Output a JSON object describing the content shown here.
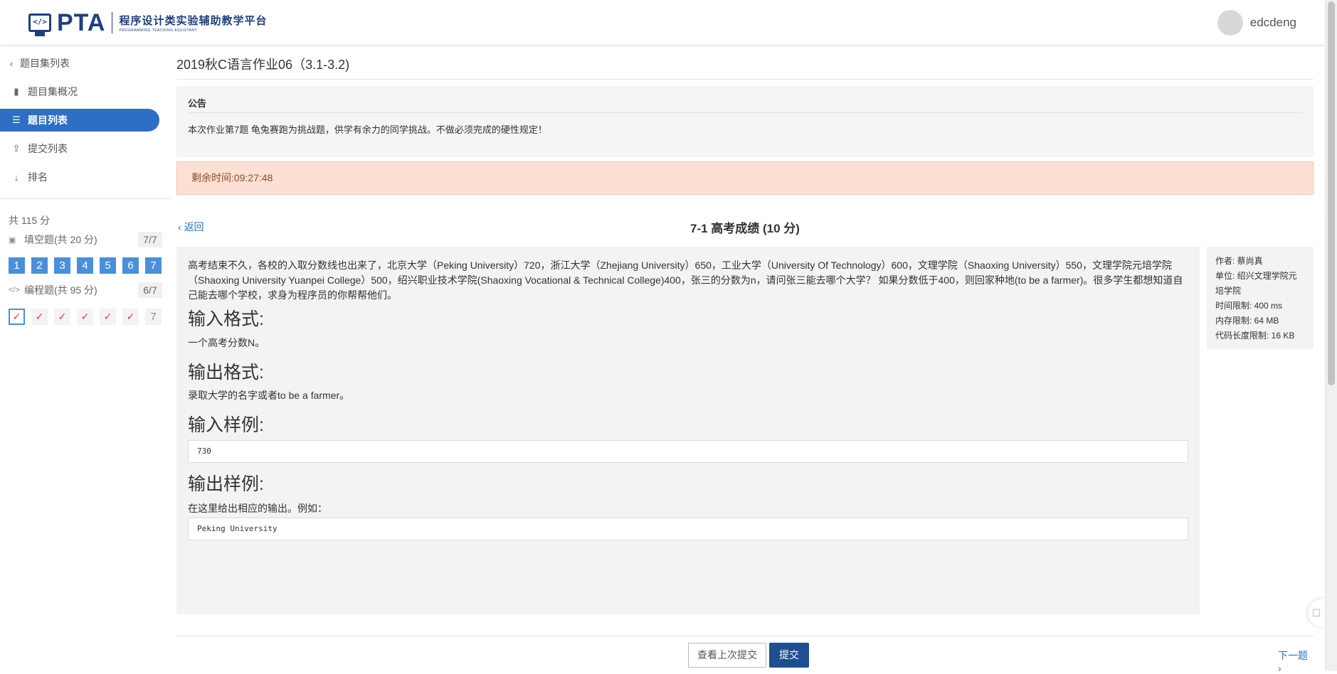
{
  "header": {
    "logo_icon": "</>",
    "logo_text": "PTA",
    "logo_cn": "程序设计类实验辅助教学平台",
    "logo_sub": "PROGRAMMING TEACHING ASSISTANT",
    "username": "edcdeng"
  },
  "sidebar": {
    "back_label": "题目集列表",
    "items": [
      {
        "label": "题目集概况",
        "icon": "book-icon"
      },
      {
        "label": "题目列表",
        "icon": "list-icon"
      },
      {
        "label": "提交列表",
        "icon": "upload-icon"
      },
      {
        "label": "排名",
        "icon": "sort-icon"
      }
    ],
    "total": "共 115 分",
    "fill_section": {
      "label": "填空题(共 20 分)",
      "count": "7/7",
      "questions": [
        "1",
        "2",
        "3",
        "4",
        "5",
        "6",
        "7"
      ]
    },
    "prog_section": {
      "label": "编程题(共 95 分)",
      "count": "6/7",
      "last": "7"
    }
  },
  "main": {
    "set_title": "2019秋C语言作业06（3.1-3.2)",
    "notice_title": "公告",
    "notice_body": "本次作业第7题 龟兔赛跑为挑战题，供学有余力的同学挑战。不做必须完成的硬性规定！",
    "timer": "剩余时间:09:27:48",
    "back": "返回",
    "problem_title": "7-1 高考成绩 (10 分)",
    "description": "高考结束不久，各校的入取分数线也出来了，北京大学（Peking University）720，浙江大学（Zhejiang University）650，工业大学（University Of Technology）600，文理学院（Shaoxing University）550，文理学院元培学院（Shaoxing University Yuanpei College）500，绍兴职业技术学院(Shaoxing Vocational & Technical College)400，张三的分数为n，请问张三能去哪个大学？ 如果分数低于400，则回家种地(to be a farmer)。很多学生都想知道自己能去哪个学校，求身为程序员的你帮帮他们。",
    "input_format_h": "输入格式:",
    "input_format": "一个高考分数N。",
    "output_format_h": "输出格式:",
    "output_format": "录取大学的名字或者to be a farmer。",
    "input_sample_h": "输入样例:",
    "input_sample": "730",
    "output_sample_h": "输出样例:",
    "output_sample_note": "在这里给出相应的输出。例如：",
    "output_sample": "Peking University"
  },
  "info": {
    "author": "作者: 蔡尚真",
    "unit": "单位: 绍兴文理学院元培学院",
    "time_limit": "时间限制: 400 ms",
    "memory_limit": "内存限制: 64 MB",
    "code_limit": "代码长度限制: 16 KB"
  },
  "footer": {
    "prev_submit": "查看上次提交",
    "submit": "提交",
    "next": "下一题"
  },
  "colors": {
    "accent": "#2d6fc5",
    "logo": "#1f3f7d",
    "check": "#e53935",
    "timer_bg": "#fbe0d3"
  }
}
